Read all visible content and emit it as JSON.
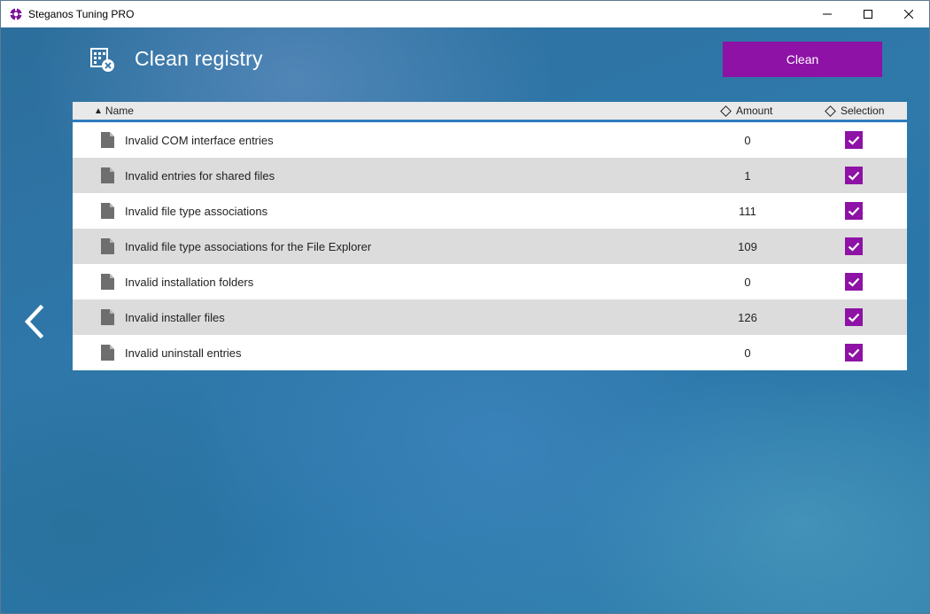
{
  "window": {
    "title": "Steganos Tuning PRO"
  },
  "colors": {
    "accent": "#8d12a5",
    "header_underline": "#2e7bbd"
  },
  "icons": {
    "app": "steganos-logo-icon",
    "minimize": "minimize-icon",
    "maximize": "maximize-icon",
    "close": "close-icon",
    "page": "registry-clean-icon",
    "back": "chevron-left-icon",
    "row": "file-icon",
    "check": "checkmark-icon"
  },
  "page": {
    "title": "Clean registry",
    "clean_label": "Clean"
  },
  "table": {
    "columns": {
      "name": "Name",
      "amount": "Amount",
      "selection": "Selection"
    },
    "sort": {
      "column": "name",
      "direction": "ascending"
    },
    "rows": [
      {
        "name": "Invalid COM interface entries",
        "amount": "0",
        "selected": true
      },
      {
        "name": "Invalid entries for shared files",
        "amount": "1",
        "selected": true
      },
      {
        "name": "Invalid file type associations",
        "amount": "111",
        "selected": true
      },
      {
        "name": "Invalid file type associations for the File Explorer",
        "amount": "109",
        "selected": true
      },
      {
        "name": "Invalid installation folders",
        "amount": "0",
        "selected": true
      },
      {
        "name": "Invalid installer files",
        "amount": "126",
        "selected": true
      },
      {
        "name": "Invalid uninstall entries",
        "amount": "0",
        "selected": true
      }
    ]
  }
}
